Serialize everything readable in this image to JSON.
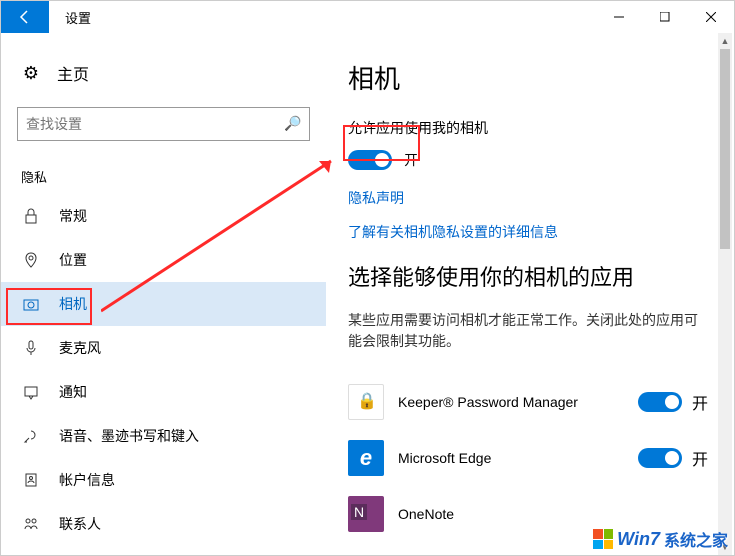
{
  "titlebar": {
    "title": "设置"
  },
  "sidebar": {
    "home": "主页",
    "search_placeholder": "查找设置",
    "section": "隐私",
    "items": [
      {
        "label": "常规"
      },
      {
        "label": "位置"
      },
      {
        "label": "相机",
        "selected": true
      },
      {
        "label": "麦克风"
      },
      {
        "label": "通知"
      },
      {
        "label": "语音、墨迹书写和键入"
      },
      {
        "label": "帐户信息"
      },
      {
        "label": "联系人"
      }
    ]
  },
  "main": {
    "heading": "相机",
    "allow_text": "允许应用使用我的相机",
    "toggle_state": "开",
    "privacy_link": "隐私声明",
    "learn_link": "了解有关相机隐私设置的详细信息",
    "choose_heading": "选择能够使用你的相机的应用",
    "choose_desc": "某些应用需要访问相机才能正常工作。关闭此处的应用可能会限制其功能。",
    "apps": [
      {
        "name": "Keeper® Password Manager",
        "state": "开"
      },
      {
        "name": "Microsoft Edge",
        "state": "开"
      },
      {
        "name": "OneNote",
        "state": ""
      }
    ]
  },
  "watermark": {
    "en": "Win7",
    "cn": "系统之家"
  }
}
